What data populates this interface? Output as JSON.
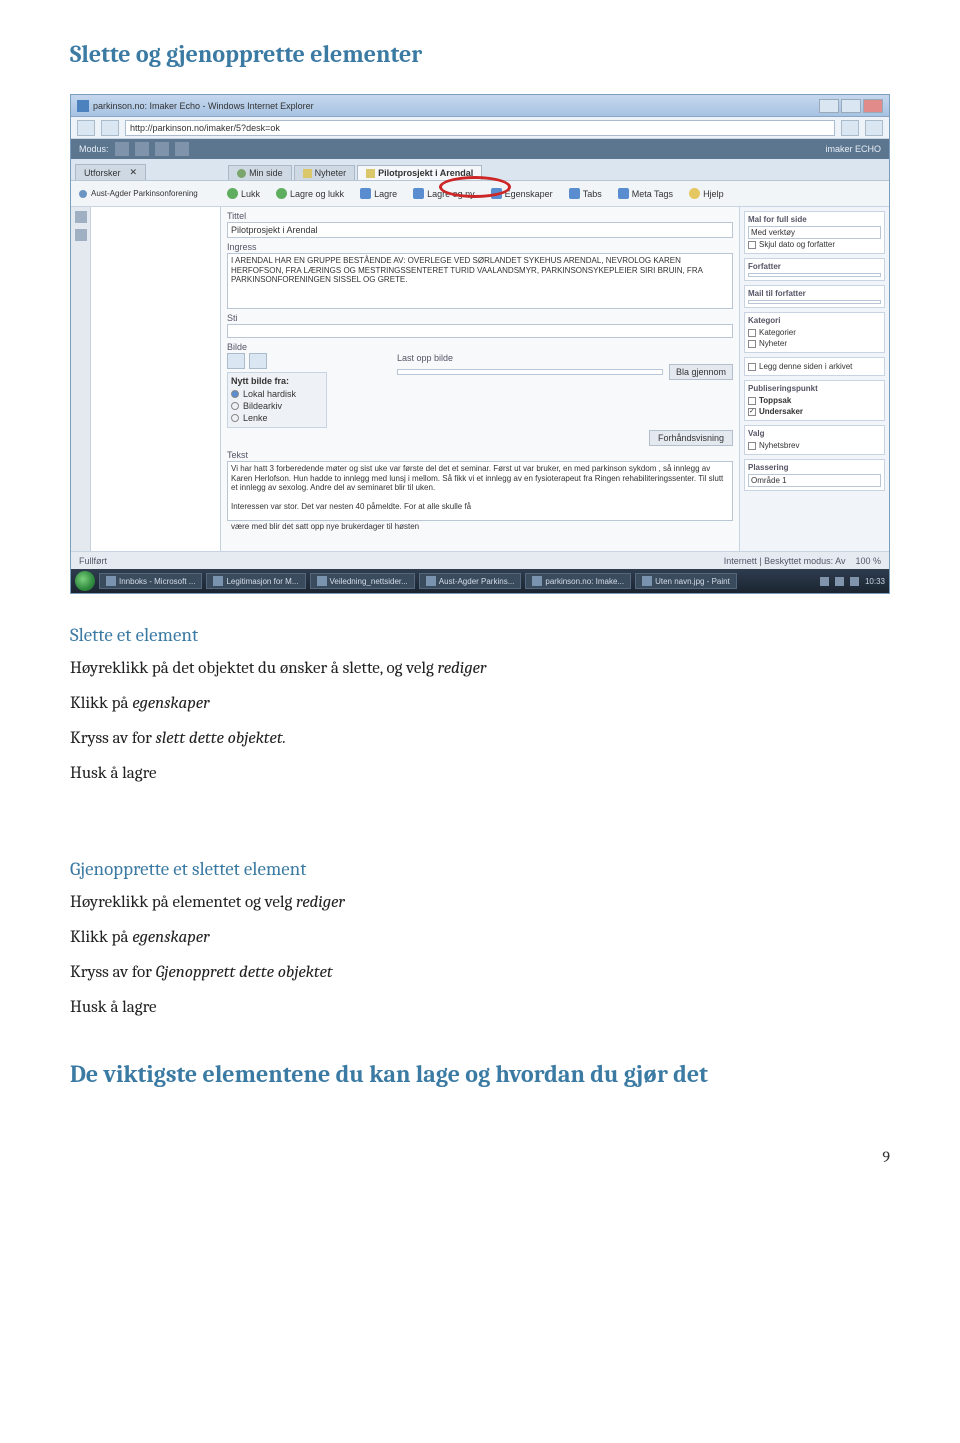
{
  "heading_main": "Slette og gjenopprette elementer",
  "section1": {
    "title": "Slette et element",
    "line1_a": "Høyreklikk på det objektet du ønsker å slette, og velg ",
    "line1_b": "rediger",
    "line2_a": "Klikk på ",
    "line2_b": "egenskaper",
    "line3_a": "Kryss av for ",
    "line3_b": "slett dette objektet.",
    "line4": "Husk å lagre"
  },
  "section2": {
    "title": "Gjenopprette et slettet element",
    "line1_a": "Høyreklikk på elementet og velg ",
    "line1_b": "rediger",
    "line2_a": "Klikk på ",
    "line2_b": "egenskaper",
    "line3_a": "Kryss av for ",
    "line3_b": "Gjenopprett dette objektet",
    "line4": "Husk å lagre"
  },
  "footer_heading": "De viktigste elementene du kan lage og hvordan du gjør det",
  "page_number": "9",
  "screenshot": {
    "window_title": "parkinson.no: Imaker Echo - Windows Internet Explorer",
    "url": "http://parkinson.no/imaker/5?desk=ok",
    "module_label": "Modus:",
    "brand": "imaker ECHO",
    "explorer_tab": "Utforsker",
    "tree_root": "Aust-Agder Parkinsonforening",
    "tabs": [
      "Min side",
      "Nyheter",
      "Pilotprosjekt i Arendal"
    ],
    "toolbar": [
      "Lukk",
      "Lagre og lukk",
      "Lagre",
      "Lagre og ny",
      "Egenskaper",
      "Tabs",
      "Meta Tags",
      "Hjelp"
    ],
    "titel_label": "Tittel",
    "titel_value": "Pilotprosjekt i Arendal",
    "ingress_label": "Ingress",
    "ingress_value": "I ARENDAL HAR EN GRUPPE BESTÅENDE AV: OVERLEGE VED SØRLANDET SYKEHUS ARENDAL, NEVROLOG KAREN HERFOFSON, FRA LÆRINGS OG MESTRINGSSENTERET TURID VAALANDSMYR, PARKINSONSYKEPLEIER SIRI BRUIN, FRA PARKINSONFORENINGEN SISSEL OG GRETE.",
    "sti_label": "Sti",
    "bilde_label": "Bilde",
    "nytt_bilde_label": "Nytt bilde fra:",
    "bilde_options": [
      "Lokal hardisk",
      "Bildearkiv",
      "Lenke"
    ],
    "lastopp_label": "Last opp bilde",
    "blagjennom": "Bla gjennom",
    "forhandsvisning": "Forhåndsvisning",
    "tekst_label": "Tekst",
    "tekst_value": "Vi har hatt 3 forberedende møter og sist uke var første del det et seminar. Først ut var bruker, en med parkinson sykdom , så innlegg av Karen Herlofson. Hun hadde to innlegg med lunsj i mellom. Så fikk vi et innlegg av en fysioterapeut fra Ringen rehabiliteringssenter. Til slutt et innlegg av sexolog. Andre del av seminaret blir til uken.\n\nInteressen var stor. Det var nesten 40 påmeldte. For at alle skulle få\n\nvære med blir det satt opp nye brukerdager til høsten",
    "right": {
      "mal_label": "Mal for full side",
      "mal_value": "Med verktøy",
      "skjul": "Skjul dato og forfatter",
      "forfatter": "Forfatter",
      "mail": "Mail til forfatter",
      "kategori_label": "Kategori",
      "kategori_items": [
        "Kategorier",
        "Nyheter"
      ],
      "arkiv": "Legg denne siden i arkivet",
      "pub_label": "Publiseringspunkt",
      "pub_items": [
        "Toppsak",
        "Undersaker"
      ],
      "valg_label": "Valg",
      "valg_item": "Nyhetsbrev",
      "plassering_label": "Plassering",
      "plassering_value": "Område 1"
    },
    "status_left": "Fullført",
    "status_right": "Internett | Beskyttet modus: Av",
    "zoom": "100 %",
    "taskbar": [
      "Innboks - Microsoft ...",
      "Legitimasjon for M...",
      "Veiledning_nettsider...",
      "Aust-Agder Parkins...",
      "parkinson.no: Imake...",
      "Uten navn.jpg - Paint"
    ],
    "clock": "10:33"
  }
}
